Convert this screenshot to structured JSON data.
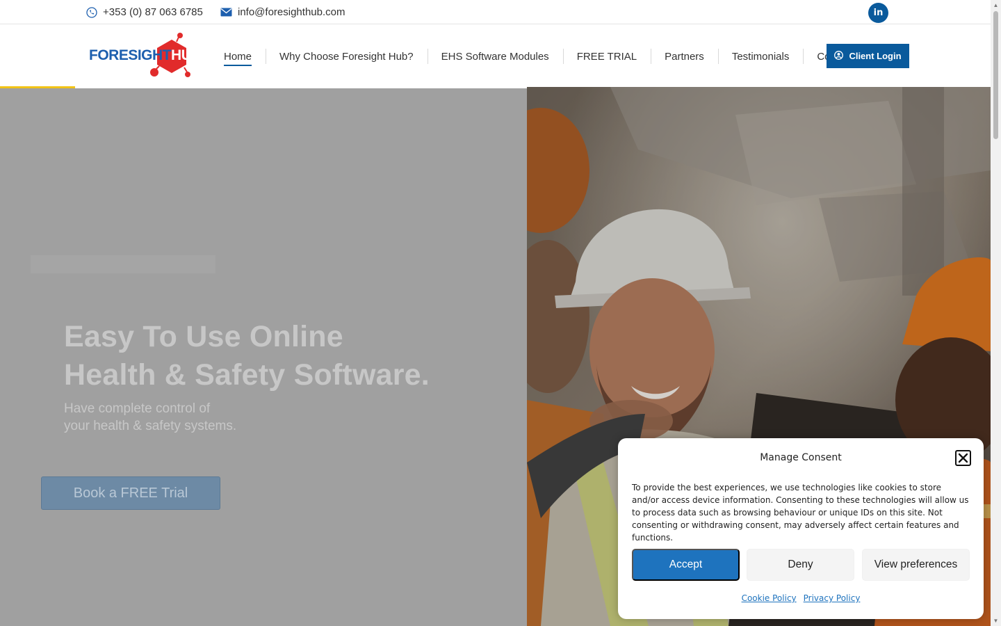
{
  "topbar": {
    "phone": "+353 (0) 87 063 6785",
    "email": "info@foresighthub.com",
    "social_icon_text": "in"
  },
  "header": {
    "logo": {
      "part1": "FORESIGHT",
      "part2": "HUB"
    },
    "nav": [
      {
        "label": "Home",
        "active": true
      },
      {
        "label": "Why Choose Foresight Hub?"
      },
      {
        "label": "EHS Software Modules"
      },
      {
        "label": "FREE TRIAL"
      },
      {
        "label": "Partners"
      },
      {
        "label": "Testimonials"
      },
      {
        "label": "Contact"
      }
    ],
    "login_label": "Client Login",
    "progress_fraction": 0.075
  },
  "hero": {
    "title_line1": "Easy To Use Online",
    "title_line2": "Health & Safety Software.",
    "subtitle_line1": "Have complete control of",
    "subtitle_line2": "your health & safety systems.",
    "cta_label": "Book a FREE Trial"
  },
  "consent": {
    "title": "Manage Consent",
    "message": "To provide the best experiences, we use technologies like cookies to store and/or access device information. Consenting to these technologies will allow us to process data such as browsing behaviour or unique IDs on this site. Not consenting or withdrawing consent, may adversely affect certain features and functions.",
    "accept_label": "Accept",
    "deny_label": "Deny",
    "preferences_label": "View preferences",
    "cookie_policy_label": "Cookie Policy",
    "privacy_policy_label": "Privacy Policy"
  },
  "colors": {
    "brand_blue": "#0a5a9c",
    "logo_red": "#e12b2b",
    "accent_yellow": "#f2c316",
    "consent_blue": "#1e73be"
  },
  "icons": {
    "phone": "phone-icon",
    "email": "envelope-icon",
    "social": "linkedin-icon",
    "login": "user-circle-icon",
    "close": "close-icon"
  }
}
